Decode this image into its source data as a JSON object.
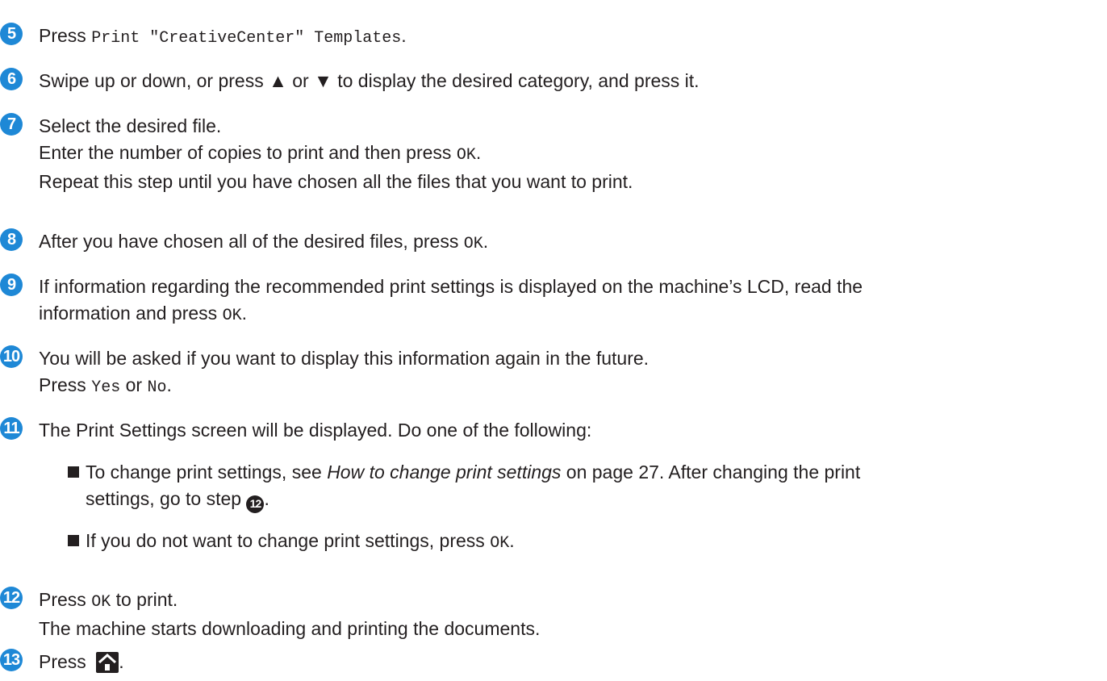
{
  "accent_color": "#1e88d6",
  "steps": [
    {
      "number": "5",
      "parts": [
        "Press ",
        "Print \"CreativeCenter\" Templates",
        "."
      ]
    },
    {
      "number": "6",
      "text": "Swipe up or down, or press ▲ or ▼ to display the desired category, and press it."
    },
    {
      "number": "7",
      "lines": [
        "Select the desired file.",
        [
          "Enter the number of copies to print and then press ",
          "OK",
          "."
        ],
        "Repeat this step until you have chosen all the files that you want to print."
      ]
    },
    {
      "number": "8",
      "parts": [
        "After you have chosen all of the desired files, press ",
        "OK",
        "."
      ]
    },
    {
      "number": "9",
      "line1": "If information regarding the recommended print settings is displayed on the machine’s LCD, read the",
      "line2_parts": [
        "information and press ",
        "OK",
        "."
      ]
    },
    {
      "number": "10",
      "line1": "You will be asked if you want to display this information again in the future.",
      "line2_parts": [
        "Press ",
        "Yes",
        " or ",
        "No",
        "."
      ]
    },
    {
      "number": "11",
      "text": "The Print Settings screen will be displayed. Do one of the following:",
      "bullets": [
        {
          "before": "To change print settings, see ",
          "link": "How to change print settings",
          "after": " on page 27. After changing the print",
          "line2": "settings, go to step ",
          "ref": "12",
          "end": "."
        },
        {
          "before": "If you do not want to change print settings, press ",
          "code": "OK",
          "end": "."
        }
      ]
    },
    {
      "number": "12",
      "parts": [
        "Press ",
        "OK",
        " to print."
      ],
      "line2": "The machine starts downloading and printing the documents."
    },
    {
      "number": "13",
      "text": "Press ",
      "icon": "home-icon",
      "end": "."
    }
  ]
}
